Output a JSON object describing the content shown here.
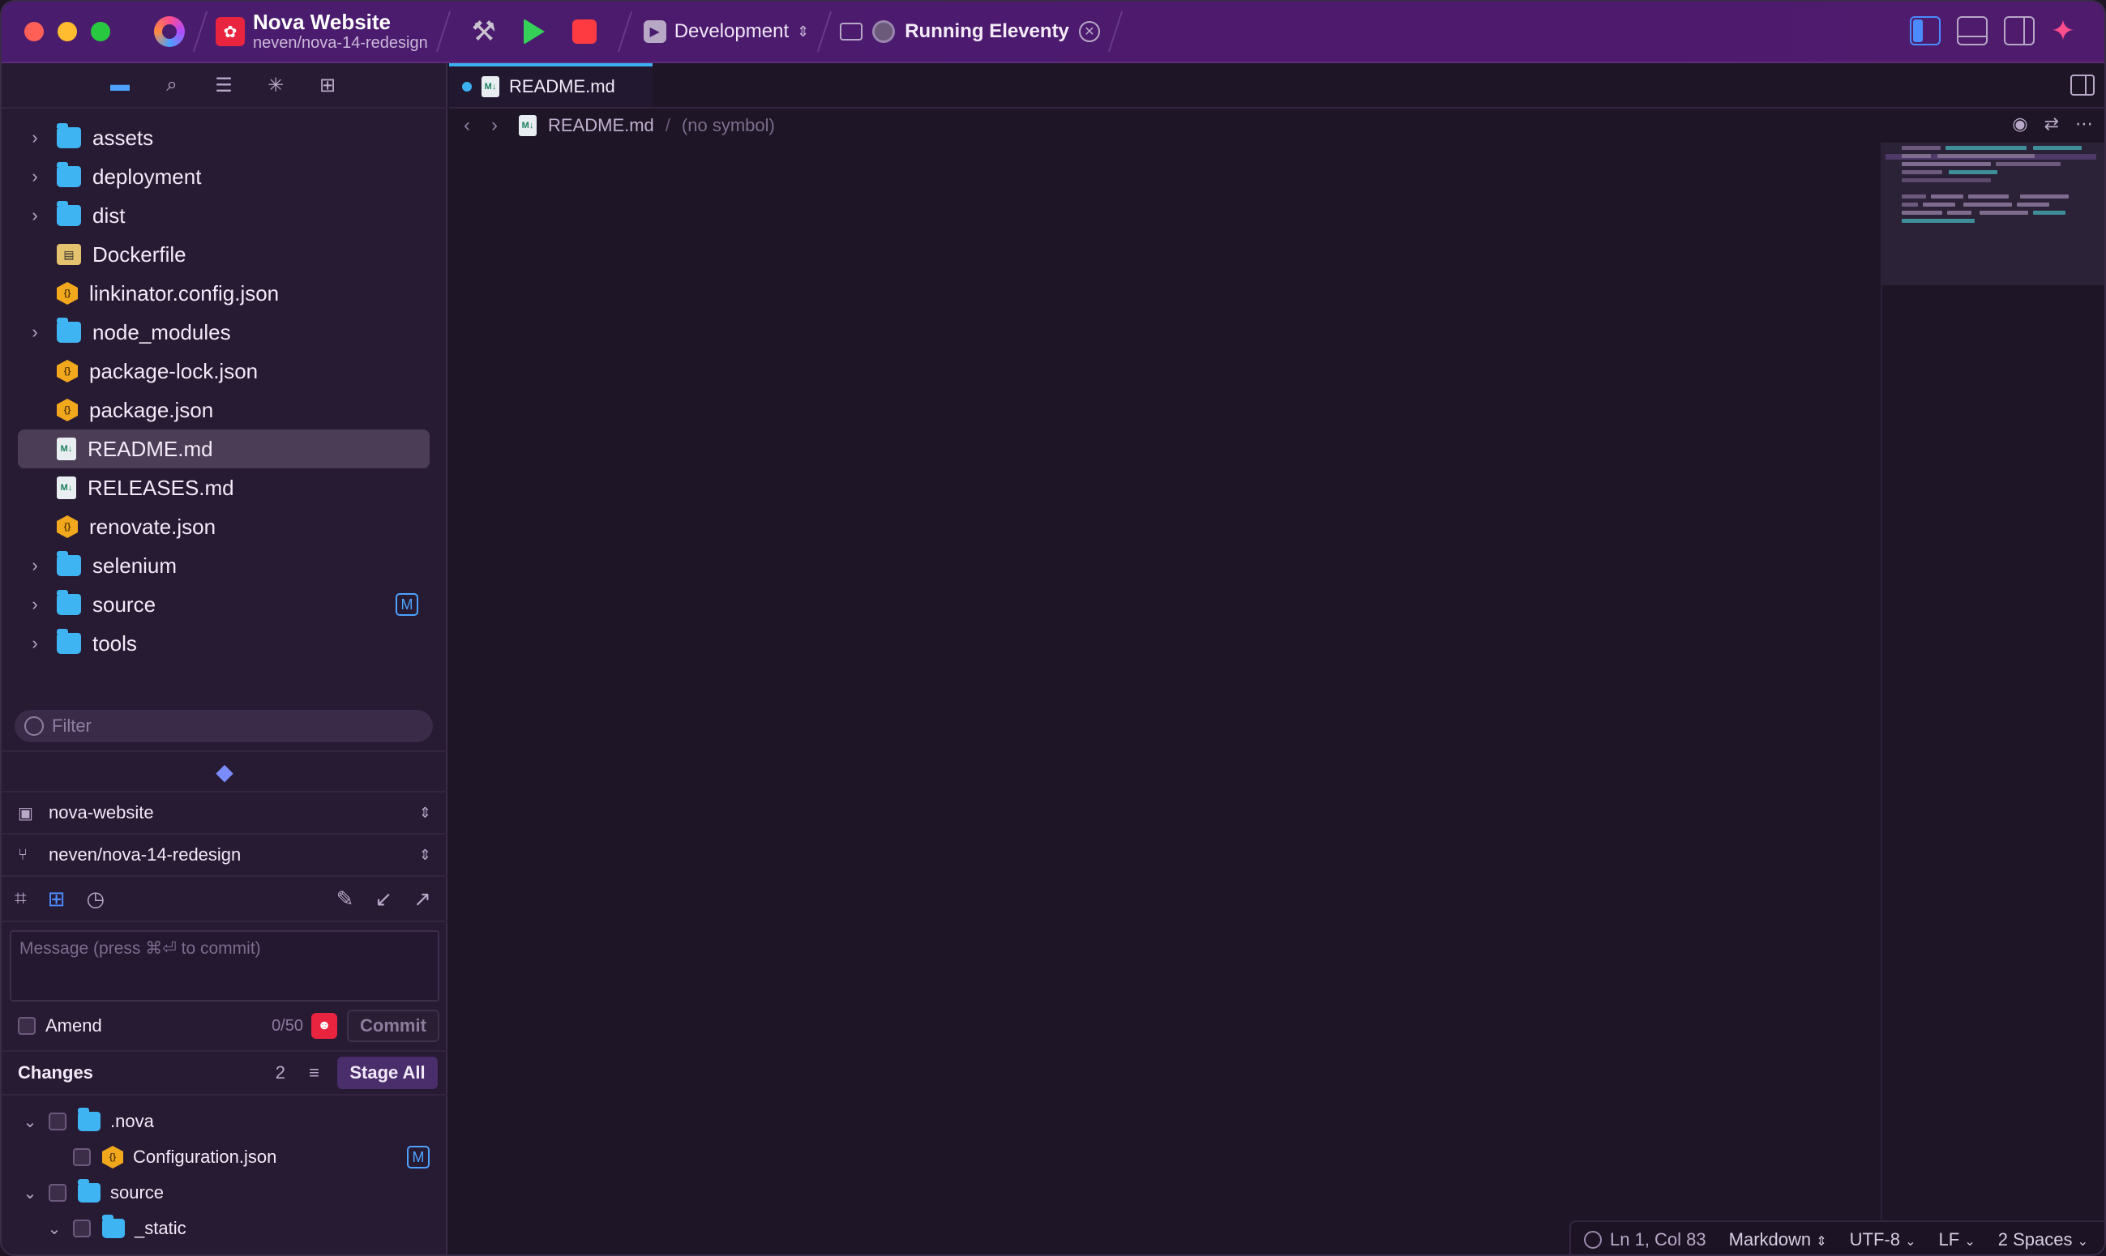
{
  "titlebar": {
    "project_name": "Nova Website",
    "project_branch": "neven/nova-14-redesign",
    "scheme": "Development",
    "task": "Running Eleventy"
  },
  "sidebar": {
    "files": [
      {
        "name": "assets",
        "type": "folder",
        "expandable": true
      },
      {
        "name": "deployment",
        "type": "folder",
        "expandable": true
      },
      {
        "name": "dist",
        "type": "folder",
        "expandable": true
      },
      {
        "name": "Dockerfile",
        "type": "docker",
        "expandable": false
      },
      {
        "name": "linkinator.config.json",
        "type": "json",
        "expandable": false
      },
      {
        "name": "node_modules",
        "type": "folder",
        "expandable": true
      },
      {
        "name": "package-lock.json",
        "type": "json",
        "expandable": false
      },
      {
        "name": "package.json",
        "type": "json",
        "expandable": false
      },
      {
        "name": "README.md",
        "type": "md",
        "expandable": false,
        "selected": true
      },
      {
        "name": "RELEASES.md",
        "type": "md",
        "expandable": false
      },
      {
        "name": "renovate.json",
        "type": "json",
        "expandable": false
      },
      {
        "name": "selenium",
        "type": "folder",
        "expandable": true
      },
      {
        "name": "source",
        "type": "folder",
        "expandable": true,
        "badge": "M"
      },
      {
        "name": "tools",
        "type": "folder",
        "expandable": true
      }
    ],
    "filter_placeholder": "Filter"
  },
  "scm": {
    "repository": "nova-website",
    "branch": "neven/nova-14-redesign",
    "message_placeholder": "Message (press ⌘⏎ to commit)",
    "amend_label": "Amend",
    "char_count": "0/50",
    "commit_label": "Commit",
    "changes_label": "Changes",
    "changes_count": "2",
    "stage_all_label": "Stage All",
    "changes": [
      {
        "name": ".nova",
        "type": "folder",
        "indent": 0,
        "expanded": true
      },
      {
        "name": "Configuration.json",
        "type": "json",
        "indent": 1,
        "badge": "M"
      },
      {
        "name": "source",
        "type": "folder",
        "indent": 0,
        "expanded": true
      },
      {
        "name": "_static",
        "type": "folder",
        "indent": 1,
        "expanded": true
      }
    ]
  },
  "editor": {
    "tab_label": "README.md",
    "breadcrumb_file": "README.md",
    "breadcrumb_symbol": "(no symbol)"
  },
  "status": {
    "position": "Ln 1, Col 83",
    "language": "Markdown",
    "encoding": "UTF-8",
    "line_ending": "LF",
    "indent": "2 Spaces"
  }
}
